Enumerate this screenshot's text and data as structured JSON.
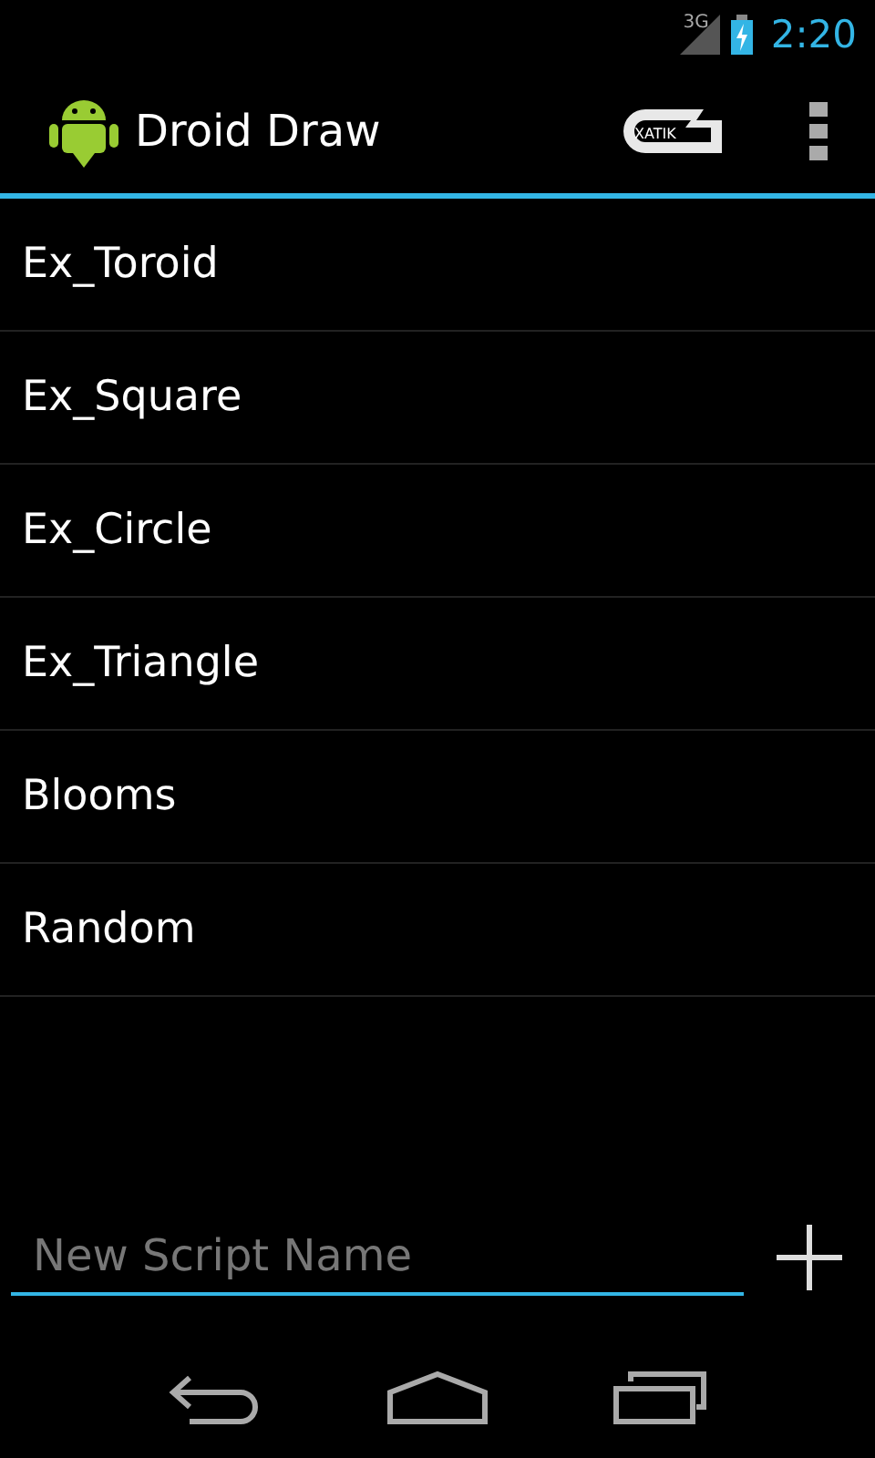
{
  "status_bar": {
    "network": "3G",
    "time": "2:20"
  },
  "action_bar": {
    "title": "Droid Draw",
    "logo_text": "XATIK"
  },
  "scripts": [
    {
      "name": "Ex_Toroid"
    },
    {
      "name": "Ex_Square"
    },
    {
      "name": "Ex_Circle"
    },
    {
      "name": "Ex_Triangle"
    },
    {
      "name": "Blooms"
    },
    {
      "name": "Random"
    }
  ],
  "new_script": {
    "placeholder": "New Script Name"
  }
}
